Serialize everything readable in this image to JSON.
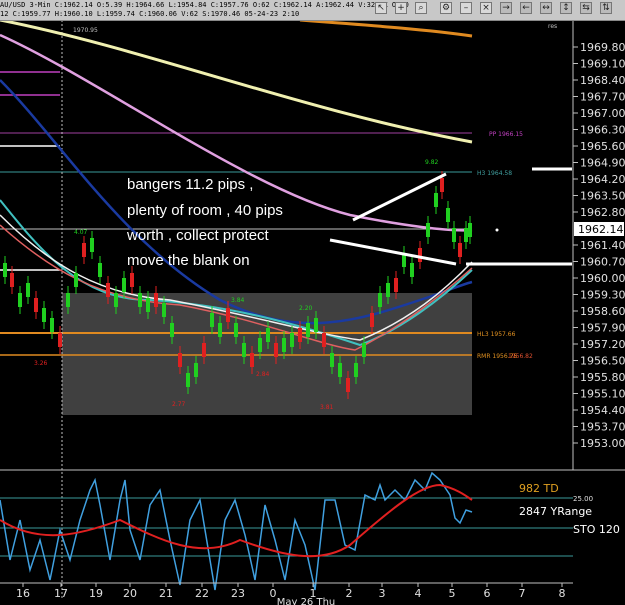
{
  "header": {
    "ohlc_line1": "AU/USD 3-Min C:1962.14 O:5.39 H:1964.66 L:1954.84 C:1957.76 O:62 C:1962.14 A:1962.44 V:32.8K OI:0",
    "ohlc_line2": "12 C:1959.77 H:1960.10 L:1959.74 C:1960.06 V:62 S:1970.46 05-24-23 2:10"
  },
  "toolbar": {
    "icons": [
      "cursor-icon",
      "crosshair-icon",
      "zoom-icon",
      "settings-icon",
      "minimize-icon",
      "close-icon"
    ],
    "rate_label": "res"
  },
  "chart_data": {
    "type": "line",
    "price_axis": {
      "labels": [
        "1969.80",
        "1969.10",
        "1968.40",
        "1967.70",
        "1967.00",
        "1966.30",
        "1965.60",
        "1964.90",
        "1964.20",
        "1963.50",
        "1962.80",
        "1962.14",
        "1961.40",
        "1960.70",
        "1960.00",
        "1959.30",
        "1958.60",
        "1957.90",
        "1957.20",
        "1956.50",
        "1955.80",
        "1955.10",
        "1954.40",
        "1953.70",
        "1953.00"
      ],
      "current_price": "1962.14"
    },
    "time_axis": {
      "labels": [
        "16",
        "17",
        "19",
        "20",
        "21",
        "22",
        "23",
        "0",
        "1",
        "2",
        "3",
        "4",
        "5",
        "6",
        "7",
        "8"
      ],
      "date_label": "May 26 Thu"
    },
    "levels": [
      {
        "name": "PP",
        "label": "PP 1966.15",
        "color": "#c040c0"
      },
      {
        "name": "H3",
        "label": "H3 1964.58",
        "color": "#40a0a0"
      },
      {
        "name": "HL3",
        "label": "HL3 1957.66",
        "color": "#e09020"
      },
      {
        "name": "RMR",
        "label": "RMR 1956.75",
        "color": "#e09020"
      },
      {
        "name": "RMR2",
        "label": "1956.82",
        "color": "#e05030"
      }
    ],
    "swing_labels": {
      "top_left": "1970.95",
      "peak": "9.82",
      "a": "4.07",
      "b": "3.84",
      "c": "2.20",
      "d": "3.26",
      "e": "2.77",
      "f": "2.84",
      "g": "3.81"
    },
    "indicator": {
      "label_td": "982 TD",
      "label_yrange": "2847 YRange",
      "label_sto": "STO 120",
      "level_label": "25.00"
    }
  },
  "annotation": {
    "line1": "bangers 11.2 pips ,",
    "line2": "plenty of room , 40 pips",
    "line3": "worth , collect protect",
    "line4": "move the blank on"
  }
}
